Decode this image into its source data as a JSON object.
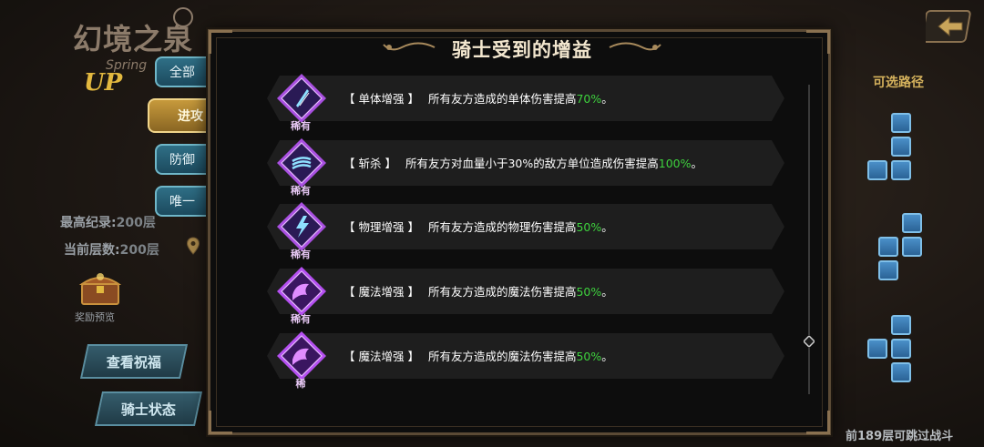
{
  "logo": {
    "title": "幻境之泉",
    "sub": "Spring",
    "up": "UP"
  },
  "tabs": [
    {
      "label": "全部",
      "active": false
    },
    {
      "label": "进攻",
      "active": true
    },
    {
      "label": "防御",
      "active": false
    },
    {
      "label": "唯一",
      "active": false
    }
  ],
  "records": {
    "best_label": "最高纪录:",
    "best_value": "200层",
    "current_label": "当前层数:",
    "current_value": "200层"
  },
  "reward_preview": "奖励预览",
  "buttons": {
    "view_blessing": "查看祝福",
    "knight_status": "骑士状态"
  },
  "right_panel": {
    "path_title": "可选路径",
    "skip_text": "前189层可跳过战斗"
  },
  "modal": {
    "title": "骑士受到的增益",
    "rows": [
      {
        "name": "【 单体增强 】",
        "desc": "所有友方造成的单体伤害提高",
        "pct": "70%",
        "end": "。",
        "rarity": "稀有",
        "icon": "slash-blade-icon",
        "theme": "blue"
      },
      {
        "name": "【 斩杀 】",
        "desc": "所有友方对血量小于30%的敌方单位造成伤害提高",
        "pct": "100%",
        "end": "。",
        "rarity": "稀有",
        "icon": "wind-slash-icon",
        "theme": "blue"
      },
      {
        "name": "【 物理增强 】",
        "desc": "所有友方造成的物理伤害提高",
        "pct": "50%",
        "end": "。",
        "rarity": "稀有",
        "icon": "lightning-icon",
        "theme": "blue"
      },
      {
        "name": "【 魔法增强 】",
        "desc": "所有友方造成的魔法伤害提高",
        "pct": "50%",
        "end": "。",
        "rarity": "稀有",
        "icon": "magic-swirl-icon",
        "theme": "purple"
      },
      {
        "name": "【 魔法增强 】",
        "desc": "所有友方造成的魔法伤害提高",
        "pct": "50%",
        "end": "。",
        "rarity": "稀",
        "icon": "magic-swirl-icon",
        "theme": "purple"
      }
    ]
  },
  "colors": {
    "accent_green": "#3ed23e",
    "gold": "#d4b15c",
    "tab_blue": "#2f6f86",
    "tab_gold": "#c79a3c"
  }
}
